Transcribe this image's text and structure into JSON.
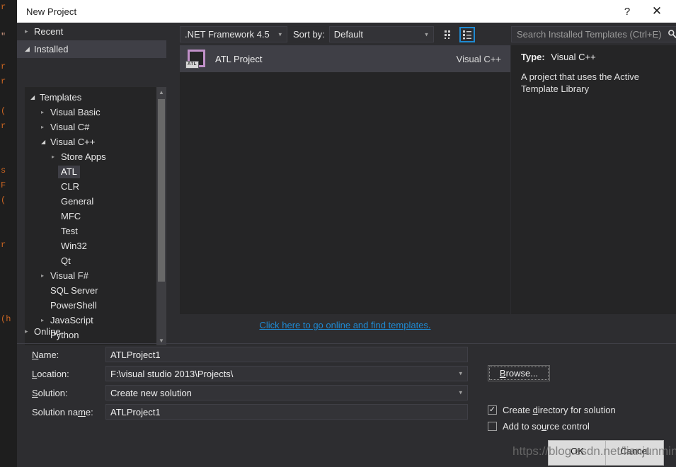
{
  "window": {
    "title": "New Project",
    "help_label": "?",
    "close_label": "✕"
  },
  "categories": [
    {
      "label": "Recent",
      "expander": "▸",
      "selected": false
    },
    {
      "label": "Installed",
      "expander": "◢",
      "selected": true
    },
    {
      "label": "Online",
      "expander": "▸",
      "selected": false
    }
  ],
  "tree": [
    {
      "label": "Templates",
      "indent": 0,
      "expander": "◢",
      "selected": false
    },
    {
      "label": "Visual Basic",
      "indent": 1,
      "expander": "▸",
      "selected": false
    },
    {
      "label": "Visual C#",
      "indent": 1,
      "expander": "▸",
      "selected": false
    },
    {
      "label": "Visual C++",
      "indent": 1,
      "expander": "◢",
      "selected": false
    },
    {
      "label": "Store Apps",
      "indent": 2,
      "expander": "▸",
      "selected": false
    },
    {
      "label": "ATL",
      "indent": 2,
      "expander": "",
      "selected": true
    },
    {
      "label": "CLR",
      "indent": 2,
      "expander": "",
      "selected": false
    },
    {
      "label": "General",
      "indent": 2,
      "expander": "",
      "selected": false
    },
    {
      "label": "MFC",
      "indent": 2,
      "expander": "",
      "selected": false
    },
    {
      "label": "Test",
      "indent": 2,
      "expander": "",
      "selected": false
    },
    {
      "label": "Win32",
      "indent": 2,
      "expander": "",
      "selected": false
    },
    {
      "label": "Qt",
      "indent": 2,
      "expander": "",
      "selected": false
    },
    {
      "label": "Visual F#",
      "indent": 1,
      "expander": "▸",
      "selected": false
    },
    {
      "label": "SQL Server",
      "indent": 1,
      "expander": "",
      "selected": false
    },
    {
      "label": "PowerShell",
      "indent": 1,
      "expander": "",
      "selected": false
    },
    {
      "label": "JavaScript",
      "indent": 1,
      "expander": "▸",
      "selected": false
    },
    {
      "label": "Python",
      "indent": 1,
      "expander": "",
      "selected": false
    }
  ],
  "toolbar": {
    "framework": ".NET Framework 4.5",
    "sort_by_label": "Sort by:",
    "sort_by_value": "Default",
    "caret": "▾",
    "view_small_icons": "small-icons-view",
    "view_list": "list-view"
  },
  "search": {
    "placeholder": "Search Installed Templates (Ctrl+E)",
    "magnifier": "⌕",
    "caret": "▾"
  },
  "templates": [
    {
      "name": "ATL Project",
      "language": "Visual C++",
      "icon_badge": "ATL",
      "selected": true
    }
  ],
  "online_link": "Click here to go online and find templates.",
  "details": {
    "type_label": "Type:",
    "type_value": "Visual C++",
    "description": "A project that uses the Active Template Library"
  },
  "form": {
    "rows": [
      {
        "label_pre": "",
        "label_accel": "N",
        "label_post": "ame:",
        "value": "ATLProject1",
        "has_caret": false
      },
      {
        "label_pre": "",
        "label_accel": "L",
        "label_post": "ocation:",
        "value": "F:\\visual studio 2013\\Projects\\",
        "has_caret": true
      },
      {
        "label_pre": "",
        "label_accel": "S",
        "label_post": "olution:",
        "value": "Create new solution",
        "has_caret": true
      },
      {
        "label_pre": "Solution na",
        "label_accel": "m",
        "label_post": "e:",
        "value": "ATLProject1",
        "has_caret": false
      }
    ],
    "browse": {
      "pre": "",
      "accel": "B",
      "post": "rowse..."
    },
    "checkboxes": [
      {
        "pre": "Create ",
        "accel": "d",
        "post": "irectory for solution",
        "checked": true,
        "mark": "✓"
      },
      {
        "pre": "Add to so",
        "accel": "u",
        "post": "rce control",
        "checked": false,
        "mark": ""
      }
    ]
  },
  "buttons": {
    "ok": "OK",
    "cancel": "Cancel"
  },
  "watermark": "https://blog.csdn.net/lianjunming",
  "background_code": [
    "r",
    "",
    "\"",
    "",
    "r",
    "r",
    "",
    "(",
    "r",
    "",
    "",
    "s",
    "F",
    "(",
    "",
    "",
    "r",
    "",
    "",
    "",
    "",
    "(h"
  ],
  "colors": {
    "accent_blue": "#1f8ad2",
    "dialog_bg": "#2d2d30",
    "panel_bg": "#252526",
    "selection": "#3f3f46",
    "icon_pink": "#c191c9",
    "titlebar_bg": "#ffffff"
  }
}
